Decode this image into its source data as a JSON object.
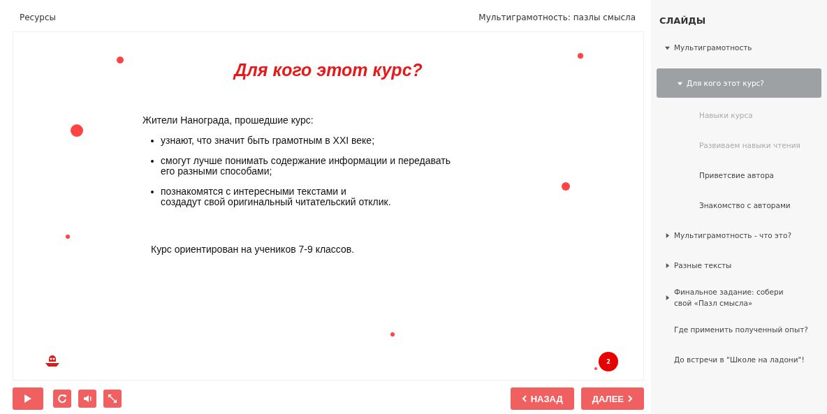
{
  "header": {
    "resources": "Ресурсы",
    "course_title": "Мультиграмотность: пазлы смысла"
  },
  "slide": {
    "title": "Для кого этот курс?",
    "intro": "Жители Нанограда, прошедшие курс:",
    "bullets": [
      "узнают, что значит быть грамотным в XXI веке;",
      "смогут лучше понимать содержание информации и передавать\nего разными способами;",
      "познакомятся с интересными текстами и\nсоздадут свой оригинальный читательский отклик."
    ],
    "footer_note": "Курс ориентирован на учеников 7-9 классов.",
    "badge": "2"
  },
  "player": {
    "back": "НАЗАД",
    "next": "ДАЛЕЕ"
  },
  "sidebar": {
    "title": "СЛАЙДЫ",
    "items": [
      {
        "label": "Мультиграмотность",
        "kind": "folder",
        "expanded": true,
        "selected": false,
        "children": [
          {
            "label": "Для кого этот курс?",
            "kind": "folder",
            "expanded": true,
            "selected": true,
            "children": [
              {
                "label": "Навыки курса",
                "selected": false,
                "disabled": true
              },
              {
                "label": "Развиваем навыки чтения",
                "selected": false,
                "disabled": true
              },
              {
                "label": "Приветсвие автора",
                "selected": false,
                "disabled": false
              },
              {
                "label": "Знакомство с авторами",
                "selected": false,
                "disabled": false
              }
            ]
          }
        ]
      },
      {
        "label": "Мультиграмотность - что это?",
        "kind": "folder",
        "expanded": false,
        "selected": false
      },
      {
        "label": "Разные тексты",
        "kind": "folder",
        "expanded": false,
        "selected": false
      },
      {
        "label": "Финальное задание: собери\nсвой «Пазл смысла»",
        "kind": "folder",
        "expanded": false,
        "selected": false
      },
      {
        "label": "Где применить полученный опыт?",
        "kind": "leaf",
        "selected": false,
        "disabled": false
      },
      {
        "label": "До встречи в \"Школе на ладони\"!",
        "kind": "leaf",
        "selected": false,
        "disabled": false
      }
    ]
  }
}
